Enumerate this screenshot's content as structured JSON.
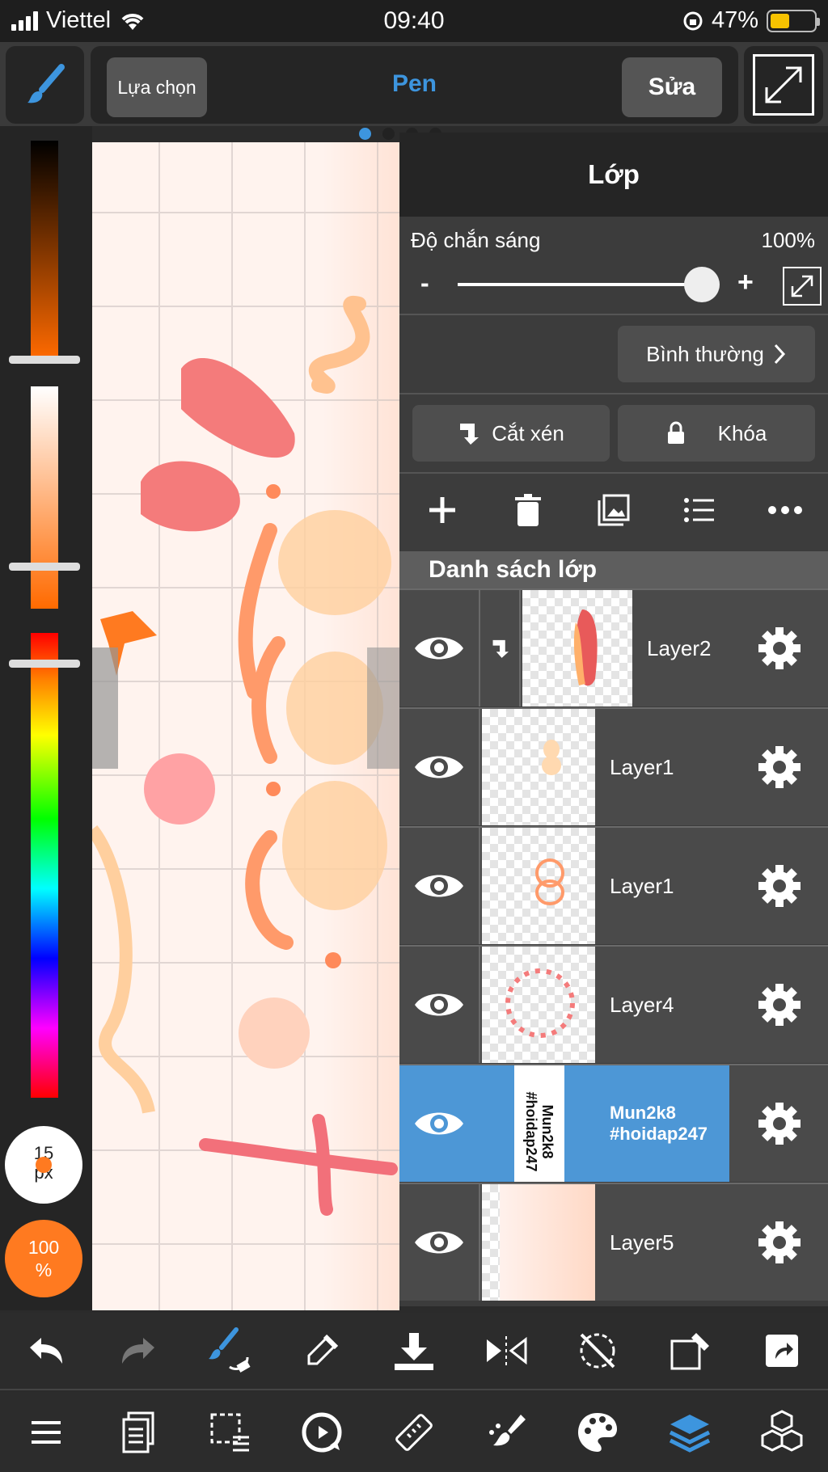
{
  "status": {
    "carrier": "Viettel",
    "time": "09:40",
    "battery": "47%"
  },
  "toolbar": {
    "select_label": "Lựa chọn",
    "tool_name": "Pen",
    "edit_label": "Sửa"
  },
  "left_panel": {
    "brush_size": "15",
    "brush_unit": "px",
    "opacity": "100",
    "opacity_unit": "%"
  },
  "layers_panel": {
    "title": "Lớp",
    "opacity_label": "Độ chắn sáng",
    "opacity_value": "100%",
    "opacity_level": 1.0,
    "minus": "-",
    "plus": "+",
    "blend_mode": "Bình thường",
    "clip_label": "Cắt xén",
    "lock_label": "Khóa",
    "list_title": "Danh sách lớp",
    "layers": [
      {
        "name": "Layer2",
        "clipped": true,
        "selected": false
      },
      {
        "name": "Layer1",
        "clipped": false,
        "selected": false
      },
      {
        "name": "Layer1",
        "clipped": false,
        "selected": false
      },
      {
        "name": "Layer4",
        "clipped": false,
        "selected": false
      },
      {
        "name": "Mun2k8 #hoidap247",
        "name_line1": "Mun2k8",
        "name_line2": "#hoidap247",
        "clipped": false,
        "selected": true
      },
      {
        "name": "Layer5",
        "clipped": false,
        "selected": false
      }
    ]
  },
  "colors": {
    "accent": "#3d95de",
    "selected_row": "#4d97d6",
    "brush_color": "#ff7a20"
  }
}
